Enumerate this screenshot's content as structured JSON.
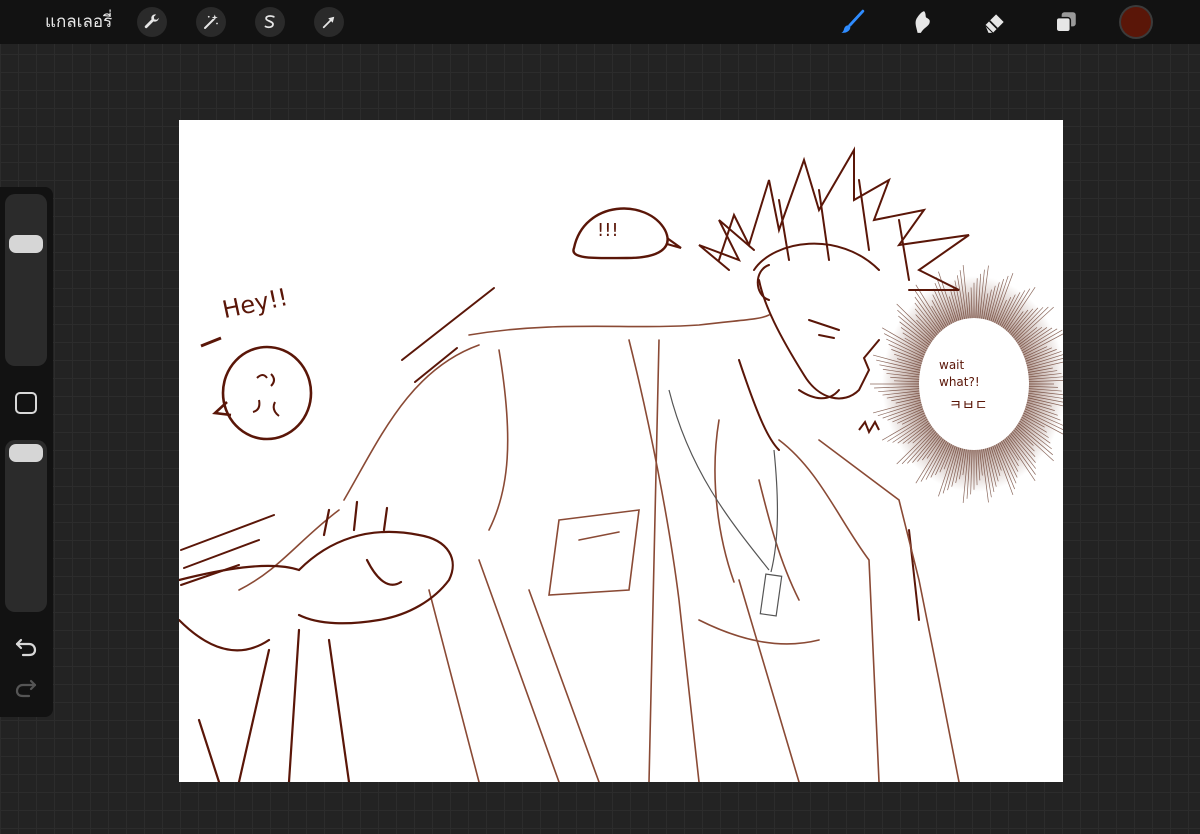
{
  "app": {
    "gallery_label": "แกลเลอรี่",
    "accent_color": "#2f8cff",
    "current_color": "#5a1608"
  },
  "top_toolbar": {
    "left_tools": [
      {
        "name": "wrench-icon",
        "label": "actions"
      },
      {
        "name": "magic-wand-icon",
        "label": "adjustments"
      },
      {
        "name": "selection-icon",
        "label": "selection"
      },
      {
        "name": "transform-arrow-icon",
        "label": "transform"
      }
    ],
    "right_tools": [
      {
        "name": "brush-icon",
        "active": true
      },
      {
        "name": "smudge-icon",
        "active": false
      },
      {
        "name": "eraser-icon",
        "active": false
      },
      {
        "name": "layers-icon",
        "active": false
      }
    ]
  },
  "sidebar": {
    "brush_size_level": 0.75,
    "opacity_level": 0.0,
    "undo_icon": "undo-icon",
    "redo_icon": "redo-icon"
  },
  "artwork": {
    "ink_color": "#5a1608",
    "sketch_color": "#8a4a35",
    "texts": {
      "hey": "Hey!!",
      "bubble_exclaim": "!!!",
      "wait": "wait",
      "what": "what?!",
      "kor": "ㅋㅂㄷ"
    }
  }
}
